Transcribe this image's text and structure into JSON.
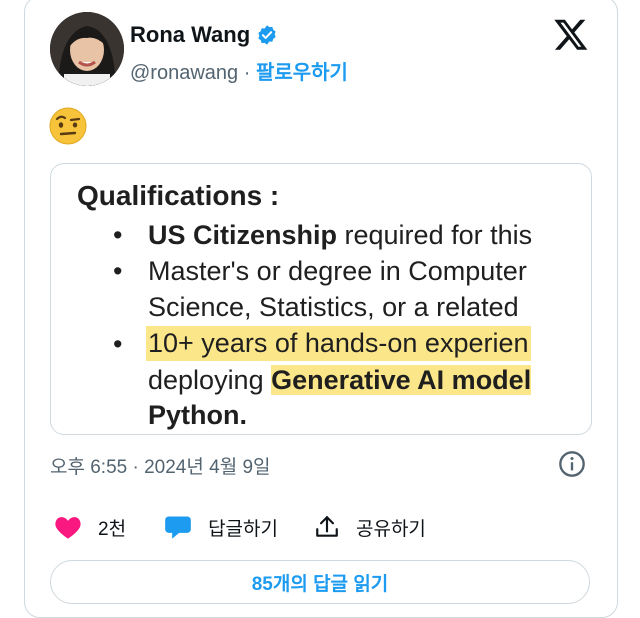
{
  "author": {
    "name": "Rona Wang",
    "handle": "@ronawang",
    "separator": "·",
    "follow_label": "팔로우하기"
  },
  "tweet": {
    "emoji": "🤨",
    "timestamp": "오후 6:55 · 2024년 4월 9일"
  },
  "image_text": {
    "heading": "Qualifications :",
    "bullet": "•",
    "l1_bold": "US Citizenship",
    "l1_rest": " required for this",
    "l2": "Master's or degree in Computer",
    "l3": "Science, Statistics, or a related",
    "l4": "10+ years of hands-on experien",
    "l5_a": "deploying ",
    "l5_b": "Generative AI model",
    "l6": "Python."
  },
  "actions": {
    "likes": "2천",
    "reply_label": "답글하기",
    "share_label": "공유하기"
  },
  "replies_button": "85개의 답글 읽기",
  "colors": {
    "accent": "#1d9bf0",
    "like": "#f91880",
    "highlight": "#fbe68a"
  },
  "icons": [
    "verified-badge-icon",
    "x-logo-icon",
    "info-icon",
    "heart-icon",
    "reply-bubble-icon",
    "share-icon"
  ]
}
